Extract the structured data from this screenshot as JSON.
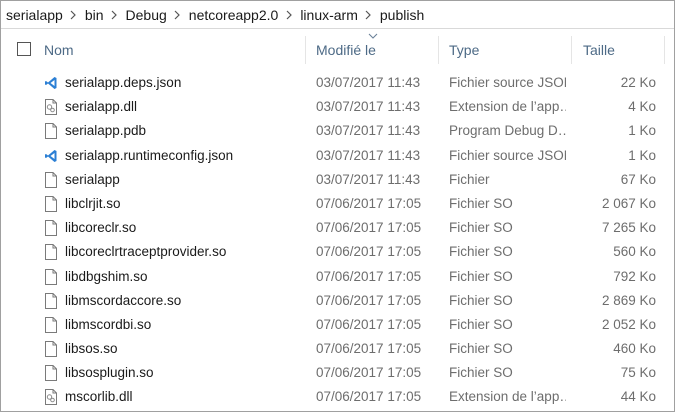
{
  "breadcrumb": [
    "serialapp",
    "bin",
    "Debug",
    "netcoreapp2.0",
    "linux-arm",
    "publish"
  ],
  "columns": {
    "name": "Nom",
    "modified": "Modifié le",
    "type": "Type",
    "size": "Taille"
  },
  "files": [
    {
      "name": "serialapp.deps.json",
      "date": "03/07/2017 11:43",
      "type": "Fichier source JSON",
      "size": "22 Ko",
      "icon": "vscode-icon"
    },
    {
      "name": "serialapp.dll",
      "date": "03/07/2017 11:43",
      "type": "Extension de l’app…",
      "size": "4 Ko",
      "icon": "dll-icon"
    },
    {
      "name": "serialapp.pdb",
      "date": "03/07/2017 11:43",
      "type": "Program Debug D…",
      "size": "1 Ko",
      "icon": "file-icon"
    },
    {
      "name": "serialapp.runtimeconfig.json",
      "date": "03/07/2017 11:43",
      "type": "Fichier source JSON",
      "size": "1 Ko",
      "icon": "vscode-icon"
    },
    {
      "name": "serialapp",
      "date": "03/07/2017 11:43",
      "type": "Fichier",
      "size": "67 Ko",
      "icon": "file-icon"
    },
    {
      "name": "libclrjit.so",
      "date": "07/06/2017 17:05",
      "type": "Fichier SO",
      "size": "2 067 Ko",
      "icon": "file-icon"
    },
    {
      "name": "libcoreclr.so",
      "date": "07/06/2017 17:05",
      "type": "Fichier SO",
      "size": "7 265 Ko",
      "icon": "file-icon"
    },
    {
      "name": "libcoreclrtraceptprovider.so",
      "date": "07/06/2017 17:05",
      "type": "Fichier SO",
      "size": "560 Ko",
      "icon": "file-icon"
    },
    {
      "name": "libdbgshim.so",
      "date": "07/06/2017 17:05",
      "type": "Fichier SO",
      "size": "792 Ko",
      "icon": "file-icon"
    },
    {
      "name": "libmscordaccore.so",
      "date": "07/06/2017 17:05",
      "type": "Fichier SO",
      "size": "2 869 Ko",
      "icon": "file-icon"
    },
    {
      "name": "libmscordbi.so",
      "date": "07/06/2017 17:05",
      "type": "Fichier SO",
      "size": "2 052 Ko",
      "icon": "file-icon"
    },
    {
      "name": "libsos.so",
      "date": "07/06/2017 17:05",
      "type": "Fichier SO",
      "size": "460 Ko",
      "icon": "file-icon"
    },
    {
      "name": "libsosplugin.so",
      "date": "07/06/2017 17:05",
      "type": "Fichier SO",
      "size": "75 Ko",
      "icon": "file-icon"
    },
    {
      "name": "mscorlib.dll",
      "date": "07/06/2017 17:05",
      "type": "Extension de l’app…",
      "size": "44 Ko",
      "icon": "dll-icon"
    }
  ]
}
